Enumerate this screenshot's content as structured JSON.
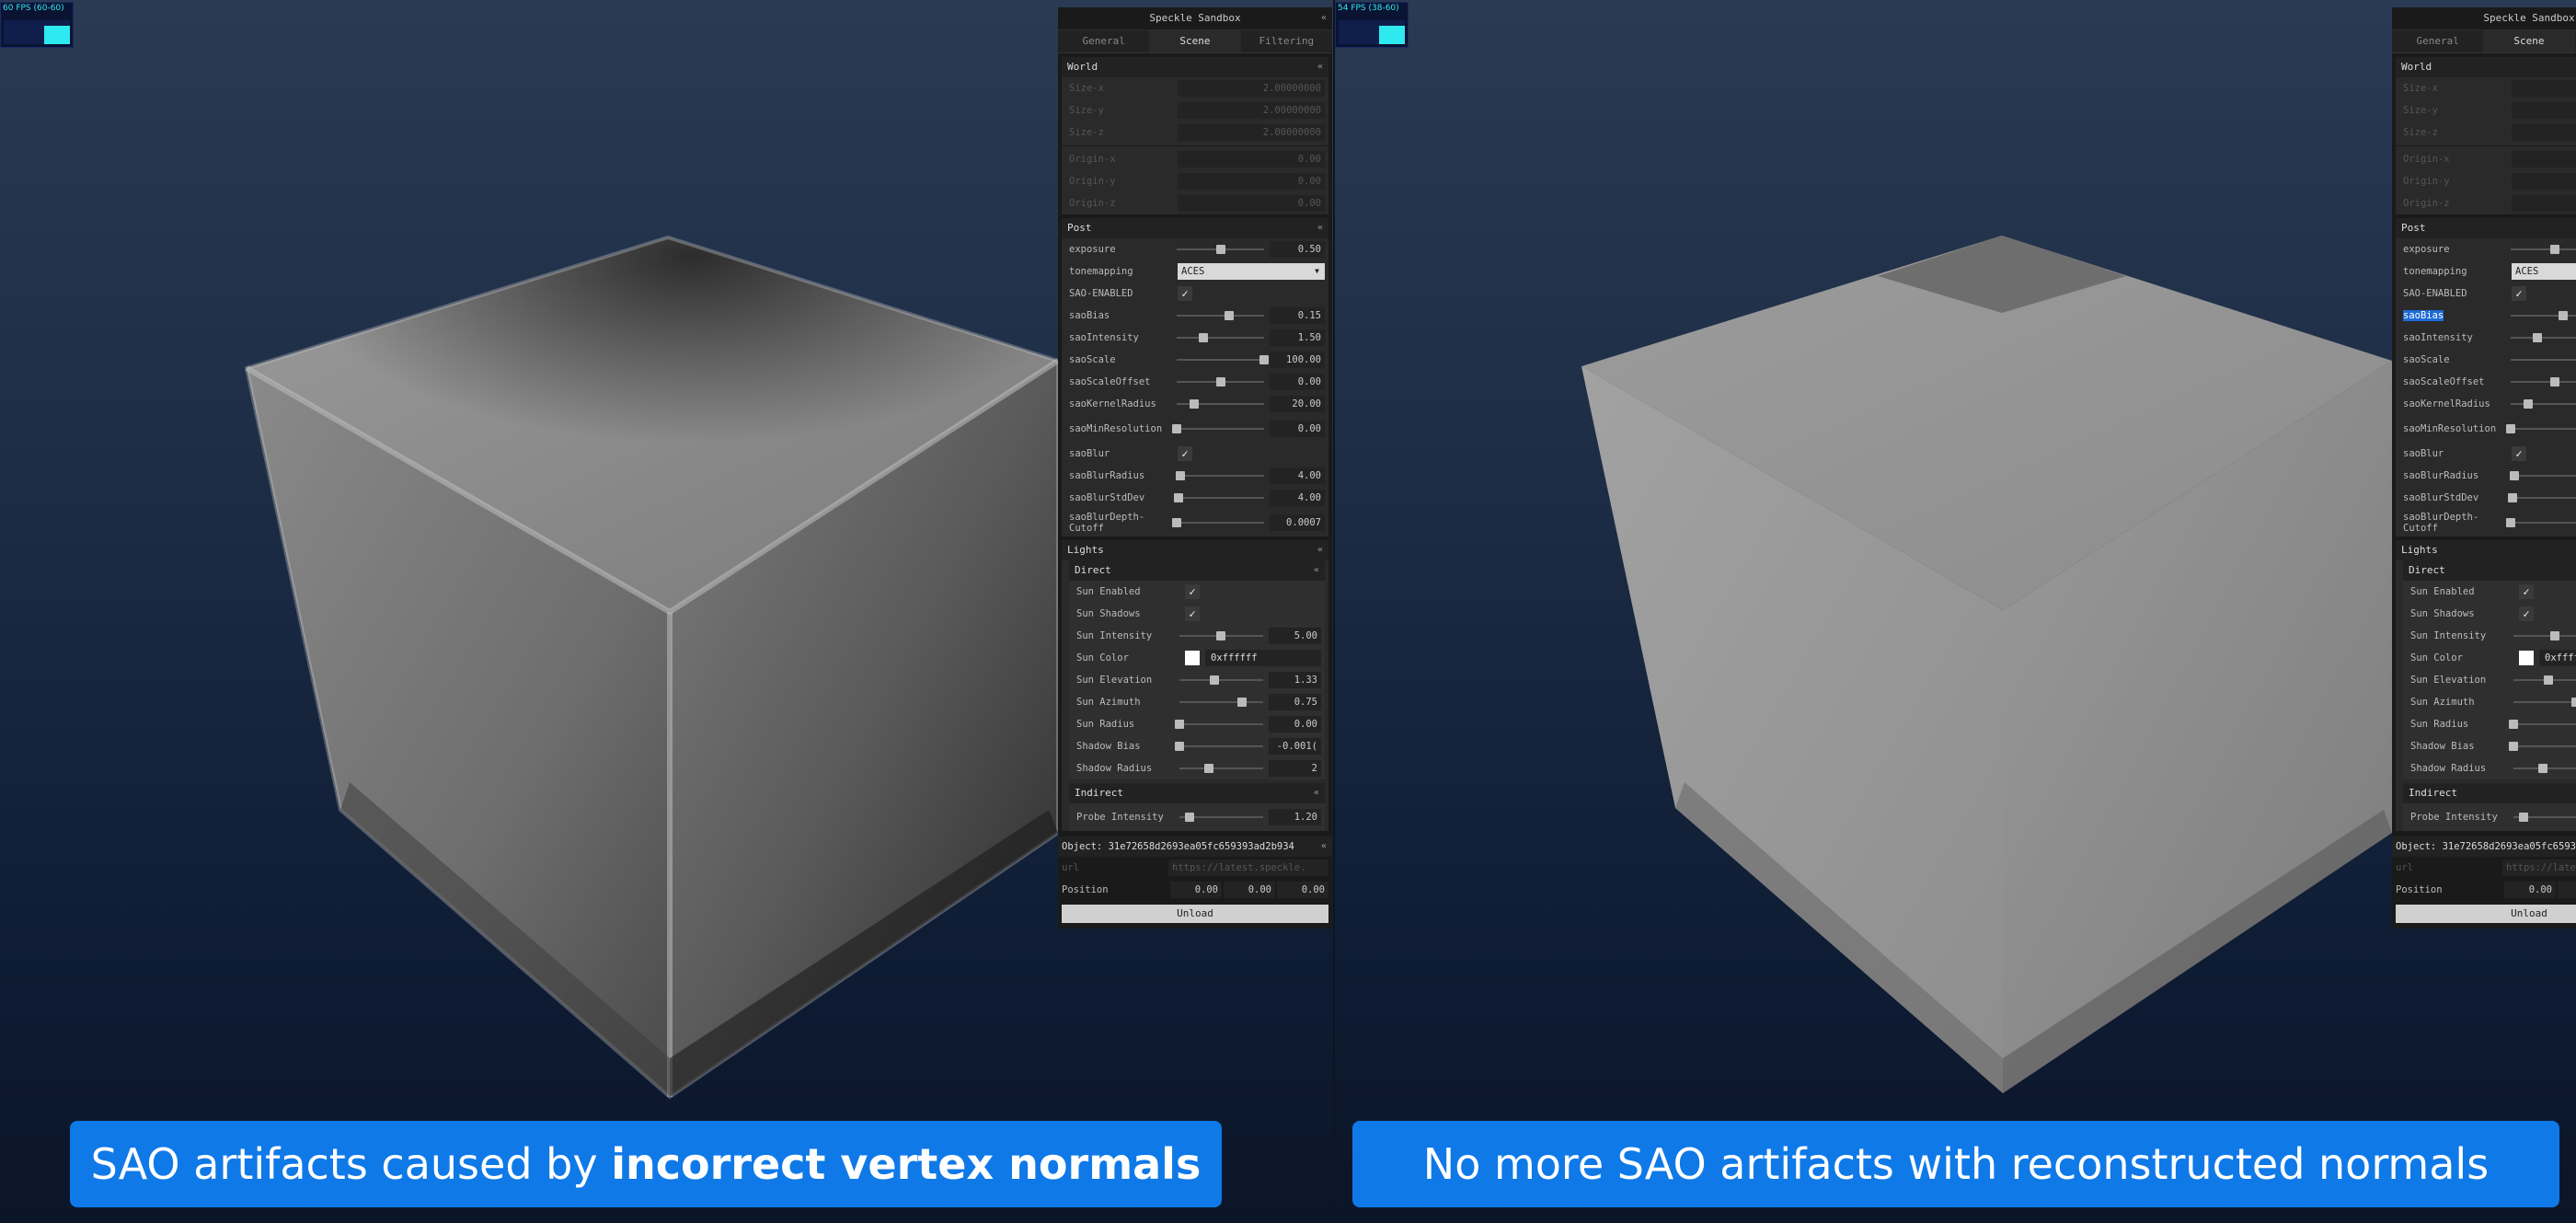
{
  "left": {
    "fps_text": "60 FPS (60-60)",
    "caption": {
      "prefix": "SAO artifacts caused by ",
      "bold": "incorrect vertex normals"
    }
  },
  "right": {
    "fps_text": "54 FPS (38-60)",
    "caption": {
      "text": "No more SAO artifacts with reconstructed normals"
    }
  },
  "gui": {
    "title": "Speckle Sandbox",
    "tabs": [
      "General",
      "Scene",
      "Filtering"
    ],
    "active_tab": "Scene",
    "world": {
      "label": "World",
      "size": [
        {
          "label": "Size-x",
          "value": "2.00000000"
        },
        {
          "label": "Size-y",
          "value": "2.00000000"
        },
        {
          "label": "Size-z",
          "value": "2.00000000"
        }
      ],
      "origin": [
        {
          "label": "Origin-x",
          "value": "0.00"
        },
        {
          "label": "Origin-y",
          "value": "0.00"
        },
        {
          "label": "Origin-z",
          "value": "0.00"
        }
      ]
    },
    "post": {
      "label": "Post",
      "exposure": {
        "label": "exposure",
        "value": "0.50",
        "level": 0.5
      },
      "tonemapping": {
        "label": "tonemapping",
        "value": "ACES"
      },
      "sao_enabled": {
        "label": "SAO-ENABLED",
        "checked": true
      },
      "saoBias": {
        "label": "saoBias",
        "value": "0.15",
        "level": 0.6
      },
      "saoIntensity": {
        "label": "saoIntensity",
        "value": "1.50",
        "level": 0.3
      },
      "saoScale": {
        "label": "saoScale",
        "value": "100.00",
        "level": 1.0
      },
      "saoScaleOffset": {
        "label": "saoScaleOffset",
        "value": "0.00",
        "level": 0.5
      },
      "saoKernelRadius": {
        "label": "saoKernelRadius",
        "value": "20.00",
        "level": 0.2
      },
      "saoMinResolution": {
        "label": "saoMinResolution",
        "value": "0.00",
        "level": 0.0
      },
      "saoBlur": {
        "label": "saoBlur",
        "checked": true
      },
      "saoBlurRadius": {
        "label": "saoBlurRadius",
        "value": "4.00",
        "level": 0.04
      },
      "saoBlurStdDev": {
        "label": "saoBlurStdDev",
        "value": "4.00",
        "level": 0.02
      },
      "saoBlurDepthCutoff": {
        "label": "saoBlurDepth-Cutoff",
        "value": "0.0007",
        "level": 0.0
      }
    },
    "lights": {
      "label": "Lights",
      "direct": {
        "label": "Direct",
        "sun_enabled": {
          "label": "Sun Enabled",
          "checked": true
        },
        "sun_shadows": {
          "label": "Sun Shadows",
          "checked": true
        },
        "sun_intensity": {
          "label": "Sun Intensity",
          "value": "5.00",
          "level": 0.5
        },
        "sun_color": {
          "label": "Sun Color",
          "value": "0xffffff",
          "swatch": "#ffffff"
        },
        "sun_elevation": {
          "label": "Sun Elevation",
          "value": "1.33",
          "level": 0.42
        },
        "sun_azimuth": {
          "label": "Sun Azimuth",
          "value": "0.75",
          "level": 0.75
        },
        "sun_radius": {
          "label": "Sun Radius",
          "value": "0.00",
          "level": 0.0
        },
        "shadow_bias": {
          "label": "Shadow Bias",
          "value": "-0.001(",
          "level": 0.0
        },
        "shadow_radius": {
          "label": "Shadow Radius",
          "value": "2",
          "level": 0.35
        }
      },
      "indirect": {
        "label": "Indirect",
        "probe_intensity": {
          "label": "Probe Intensity",
          "value": "1.20",
          "level": 0.12
        }
      }
    },
    "object": {
      "header": "Object: 31e72658d2693ea05fc659393ad2b934",
      "url_label": "url",
      "url_value": "https://latest.speckle.",
      "position_label": "Position",
      "position": [
        "0.00",
        "0.00",
        "0.00"
      ],
      "unload_label": "Unload"
    },
    "chevron": "«"
  },
  "colors": {
    "caption_bg": "#0f79e8",
    "fps_text": "#34e6f2",
    "highlight": "#1e6ad6"
  }
}
